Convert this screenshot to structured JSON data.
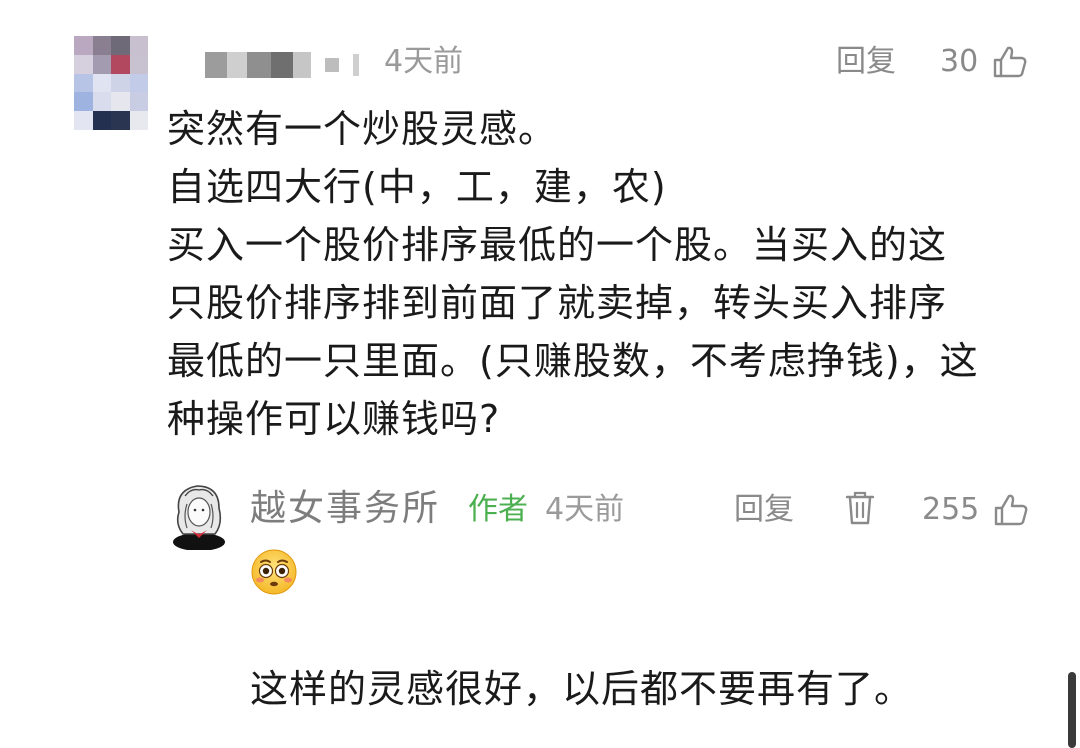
{
  "comment": {
    "time": "4天前",
    "reply_label": "回复",
    "likes": "30",
    "body_lines": [
      "突然有一个炒股灵感。",
      "自选四大行(中，工，建，农)",
      "买入一个股价排序最低的一个股。当买入的这",
      "只股价排序排到前面了就卖掉，转头买入排序",
      "最低的一只里面。(只赚股数，不考虑挣钱)，这",
      "种操作可以赚钱吗?"
    ]
  },
  "reply": {
    "author": "越女事务所",
    "badge": "作者",
    "time": "4天前",
    "reply_label": "回复",
    "likes": "255",
    "emoji": "flushed-face",
    "text": "这样的灵感很好，以后都不要再有了。"
  },
  "colors": {
    "badge_green": "#4caf50",
    "meta_gray": "#8a8a8a",
    "text": "#1a1a1a"
  }
}
